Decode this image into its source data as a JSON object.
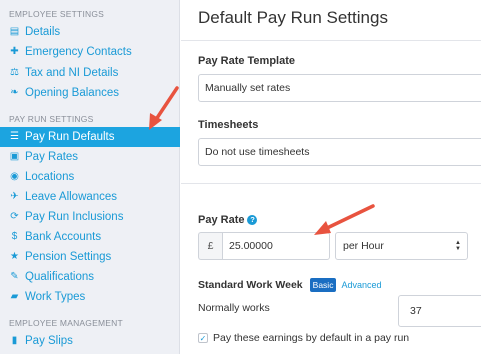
{
  "sidebar": {
    "section_employee_settings": "EMPLOYEE SETTINGS",
    "section_pay_run_settings": "PAY RUN SETTINGS",
    "section_employee_management": "EMPLOYEE MANAGEMENT",
    "items": [
      {
        "label": "Details",
        "icon": "document-icon",
        "glyph": "▤"
      },
      {
        "label": "Emergency Contacts",
        "icon": "plus-icon",
        "glyph": "✚"
      },
      {
        "label": "Tax and NI Details",
        "icon": "scales-icon",
        "glyph": "⚖"
      },
      {
        "label": "Opening Balances",
        "icon": "leaf-icon",
        "glyph": "❧"
      },
      {
        "label": "Pay Run Defaults",
        "icon": "list-icon",
        "glyph": "☰"
      },
      {
        "label": "Pay Rates",
        "icon": "money-icon",
        "glyph": "▣"
      },
      {
        "label": "Locations",
        "icon": "compass-icon",
        "glyph": "◉"
      },
      {
        "label": "Leave Allowances",
        "icon": "plane-icon",
        "glyph": "✈"
      },
      {
        "label": "Pay Run Inclusions",
        "icon": "refresh-icon",
        "glyph": "⟳"
      },
      {
        "label": "Bank Accounts",
        "icon": "dollar-circle-icon",
        "glyph": "$"
      },
      {
        "label": "Pension Settings",
        "icon": "star-icon",
        "glyph": "★"
      },
      {
        "label": "Qualifications",
        "icon": "certificate-icon",
        "glyph": "✎"
      },
      {
        "label": "Work Types",
        "icon": "folder-icon",
        "glyph": "▰"
      },
      {
        "label": "Pay Slips",
        "icon": "file-icon",
        "glyph": "▮"
      }
    ],
    "active_item": "Pay Run Defaults"
  },
  "main": {
    "title": "Default Pay Run Settings",
    "pay_rate_template": {
      "label": "Pay Rate Template",
      "value": "Manually set rates"
    },
    "timesheets": {
      "label": "Timesheets",
      "value": "Do not use timesheets"
    },
    "pay_rate": {
      "label": "Pay Rate",
      "help_glyph": "?",
      "currency": "£",
      "value": "25.00000",
      "unit": "per Hour"
    },
    "standard_work_week": {
      "label": "Standard Work Week",
      "basic_badge": "Basic",
      "advanced_link": "Advanced",
      "normally_works_label": "Normally works",
      "hours_value": "37"
    },
    "pay_by_default": {
      "label": "Pay these earnings by default in a pay run",
      "checked": true
    }
  },
  "colors": {
    "accent": "#1a9ad6",
    "active_bg": "#1ca4e0",
    "sidebar_bg": "#eef0f5",
    "annotation_arrow": "#e8533f",
    "badge_bg": "#1a6ec2"
  }
}
